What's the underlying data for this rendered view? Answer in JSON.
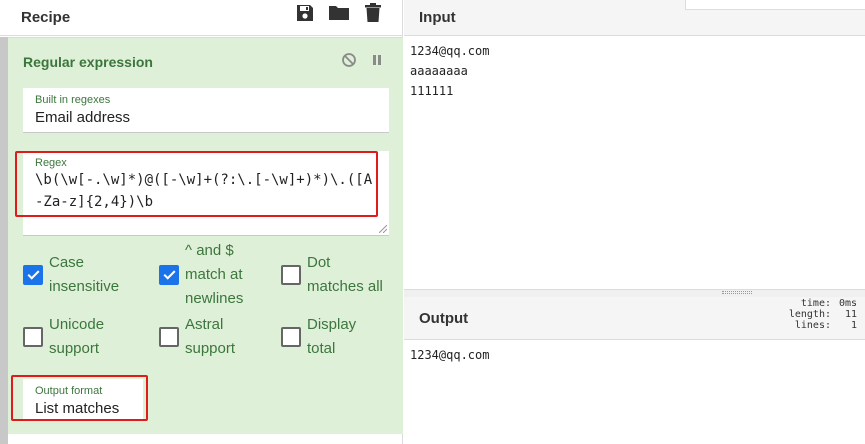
{
  "recipe": {
    "title": "Recipe",
    "actions": [
      {
        "name": "save-icon"
      },
      {
        "name": "folder-icon"
      },
      {
        "name": "trash-icon"
      }
    ]
  },
  "operation": {
    "title": "Regular expression",
    "controls": [
      "disable-icon",
      "pause-icon"
    ],
    "builtin": {
      "label": "Built in regexes",
      "value": "Email address"
    },
    "regex": {
      "label": "Regex",
      "value": "\\b(\\w[-.\\w]*)@([-\\w]+(?:\\.[-\\w]+)*)\\.([A-Za-z]{2,4})\\b"
    },
    "options": [
      {
        "label": "Case\ninsensitive",
        "checked": true
      },
      {
        "label": "^ and $\nmatch at\nnewlines",
        "checked": true
      },
      {
        "label": "Dot\nmatches all",
        "checked": false
      },
      {
        "label": "Unicode\nsupport",
        "checked": false
      },
      {
        "label": "Astral\nsupport",
        "checked": false
      },
      {
        "label": "Display\ntotal",
        "checked": false
      }
    ],
    "output_format": {
      "label": "Output format",
      "value": "List matches"
    }
  },
  "input": {
    "title": "Input",
    "lines": [
      "1234@qq.com",
      "aaaaaaaa",
      "111111"
    ]
  },
  "output": {
    "title": "Output",
    "stats": {
      "time_label": "time:",
      "time_value": "0ms",
      "length_label": "length:",
      "length_value": "11",
      "lines_label": "lines:",
      "lines_value": "1"
    },
    "lines": [
      "1234@qq.com"
    ]
  },
  "colors": {
    "accent_green": "#3c763d",
    "checkbox_blue": "#1a73e8",
    "highlight_red": "#e01b1b"
  }
}
